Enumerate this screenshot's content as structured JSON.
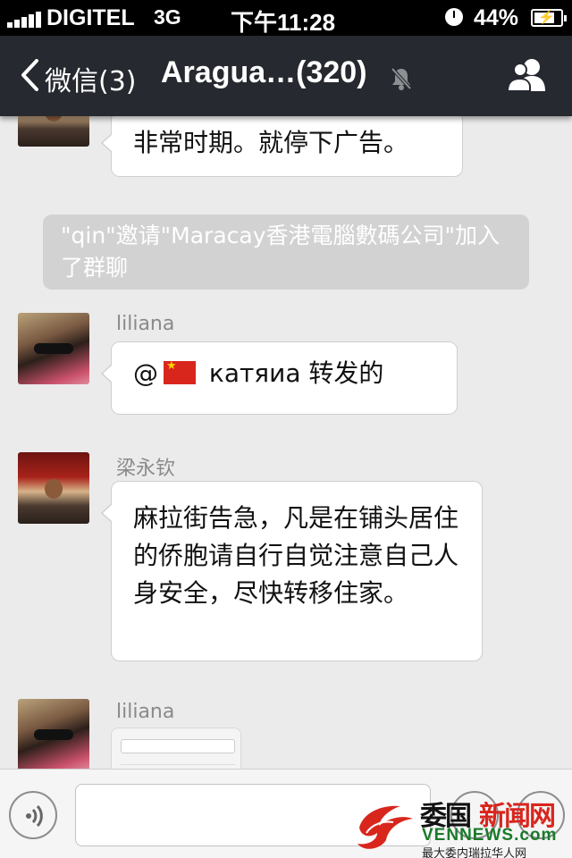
{
  "status_bar": {
    "carrier": "DIGITEL",
    "network": "3G",
    "time": "下午11:28",
    "battery": "44%"
  },
  "nav": {
    "back_label": "微信(3)",
    "title": "Aragua…(320)"
  },
  "messages": [
    {
      "sender": "",
      "text": "非常时期。就停下广告。"
    },
    {
      "system": "\"qin\"邀请\"Maracay香港電腦數碼公司\"加入了群聊"
    },
    {
      "sender": "liliana",
      "mention": "@",
      "text": " катяиа 转发的"
    },
    {
      "sender": "梁永钦",
      "text": "麻拉街告急，凡是在铺头居住的侨胞请自行自觉注意自己人身安全，尽快转移住家。"
    },
    {
      "sender": "liliana",
      "type": "image"
    }
  ],
  "watermark": {
    "cn_part1": "委国",
    "cn_part2": "新闻网",
    "en": "VENNEWS.com",
    "sub": "最大委内瑞拉华人网"
  },
  "colors": {
    "navbar": "#26292f",
    "background": "#ebebeb",
    "flag_red": "#d8261d"
  }
}
